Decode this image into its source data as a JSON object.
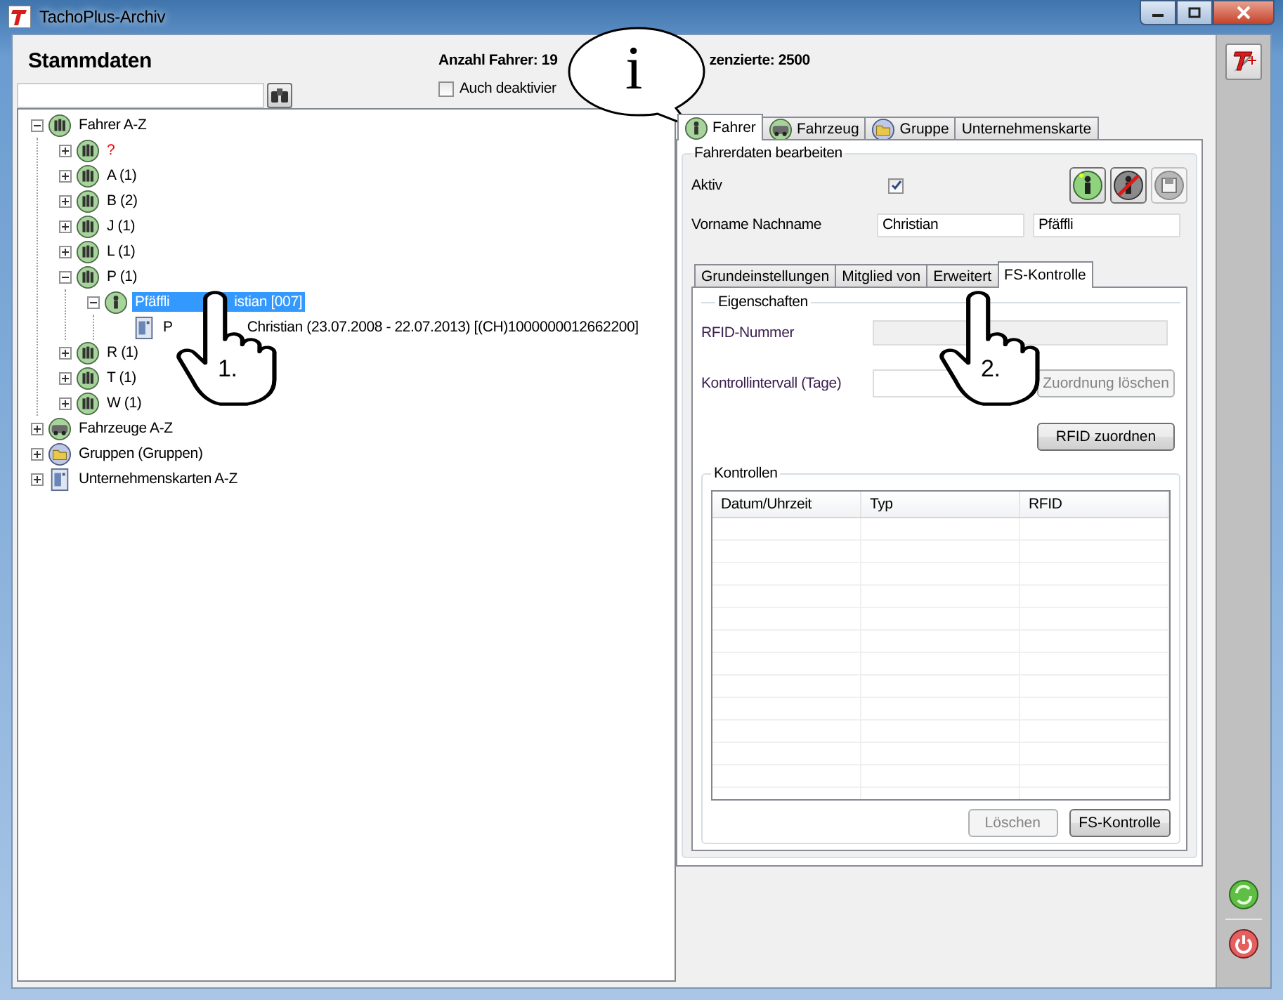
{
  "window": {
    "title": "TachoPlus-Archiv"
  },
  "header": {
    "title": "Stammdaten",
    "count_text": "Anzahl Fahrer: 19",
    "licensed_text": "zenzierte: 2500",
    "inactive_filter": {
      "label": "Auch deaktivier",
      "checked": false
    }
  },
  "tree": [
    {
      "label": "Fahrer A-Z",
      "kind": "group",
      "expanded": true,
      "selected": false,
      "children": [
        {
          "label": "?",
          "kind": "group",
          "expanded": false,
          "selected": false,
          "color": "#ff0000"
        },
        {
          "label": "A (1)",
          "kind": "group",
          "expanded": false,
          "selected": false
        },
        {
          "label": "B (2)",
          "kind": "group",
          "expanded": false,
          "selected": false
        },
        {
          "label": "J (1)",
          "kind": "group",
          "expanded": false,
          "selected": false
        },
        {
          "label": "L (1)",
          "kind": "group",
          "expanded": false,
          "selected": false
        },
        {
          "label": "P (1)",
          "kind": "group",
          "expanded": true,
          "selected": false,
          "children": [
            {
              "label_parts": [
                "Pfäffli",
                "istian [007]"
              ],
              "kind": "person",
              "expanded": true,
              "selected": true,
              "children": [
                {
                  "label_parts": [
                    "P",
                    "Christian (23.07.2008 - 22.07.2013) [(CH)1000000012662200]"
                  ],
                  "kind": "card",
                  "selected": false
                }
              ]
            }
          ]
        },
        {
          "label": "R (1)",
          "kind": "group",
          "expanded": false,
          "selected": false
        },
        {
          "label": "T (1)",
          "kind": "group",
          "expanded": false,
          "selected": false
        },
        {
          "label": "W (1)",
          "kind": "group",
          "expanded": false,
          "selected": false
        }
      ]
    },
    {
      "label": "Fahrzeuge A-Z",
      "kind": "vehicle",
      "expanded": false,
      "selected": false
    },
    {
      "label": "Gruppen (Gruppen)",
      "kind": "folder",
      "expanded": false,
      "selected": false
    },
    {
      "label": "Unternehmenskarten A-Z",
      "kind": "card",
      "expanded": false,
      "selected": false
    }
  ],
  "callout": {
    "text": "i"
  },
  "pointers": [
    {
      "label": "1."
    },
    {
      "label": "2."
    }
  ],
  "tabs": [
    {
      "label": "Fahrer",
      "kind": "person",
      "selected": true
    },
    {
      "label": "Fahrzeug",
      "kind": "vehicle",
      "selected": false
    },
    {
      "label": "Gruppe",
      "kind": "folder",
      "selected": false
    },
    {
      "label": "Unternehmenskarte",
      "kind": "text",
      "selected": false
    }
  ],
  "driver_form": {
    "title": "Fahrerdaten bearbeiten",
    "active": {
      "label": "Aktiv",
      "checked": true
    },
    "actions": [
      {
        "kind": "add-person",
        "disabled": false
      },
      {
        "kind": "remove-person",
        "disabled": false
      },
      {
        "kind": "save",
        "disabled": true
      }
    ],
    "name": {
      "label": "Vorname Nachname",
      "first_name": "Christian",
      "last_name": "Pfäffli"
    }
  },
  "subtabs": [
    {
      "label": "Grundeinstellungen",
      "selected": false
    },
    {
      "label": "Mitglied von",
      "selected": false
    },
    {
      "label": "Erweitert",
      "selected": false
    },
    {
      "label": "FS-Kontrolle",
      "selected": true
    }
  ],
  "fs_control": {
    "properties_title": "Eigenschaften",
    "rfid_label": "RFID-Nummer",
    "rfid_disabled": true,
    "interval_label": "Kontrollintervall (Tage)",
    "clear_button": {
      "label": "Zuordnung löschen",
      "disabled": true
    },
    "assign_button": {
      "label": "RFID zuordnen",
      "disabled": false
    },
    "controls_title": "Kontrollen",
    "columns": [
      "Datum/Uhrzeit",
      "Typ",
      "RFID"
    ],
    "buttons": [
      {
        "label": "Löschen",
        "disabled": true
      },
      {
        "label": "FS-Kontrolle",
        "disabled": false
      }
    ]
  }
}
